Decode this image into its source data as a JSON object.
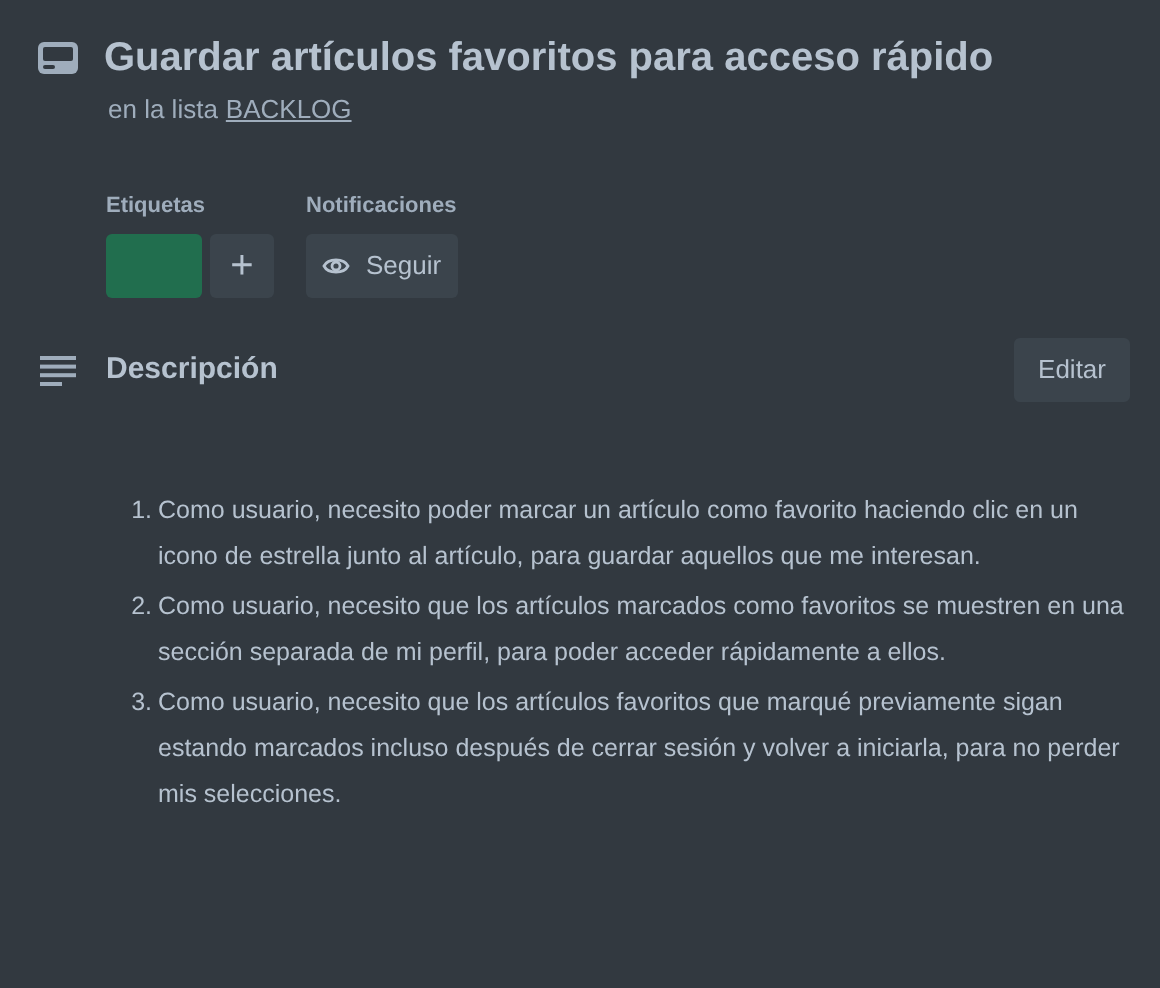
{
  "card": {
    "title": "Guardar artículos favoritos para acceso rápido",
    "list_prefix": "en la lista",
    "list_name": "BACKLOG"
  },
  "labels": {
    "heading": "Etiquetas",
    "items": [
      {
        "color": "#216e4e"
      }
    ],
    "add": "+"
  },
  "notifications": {
    "heading": "Notificaciones",
    "button": "Seguir"
  },
  "description": {
    "heading": "Descripción",
    "edit": "Editar",
    "items": [
      {
        "number": "1.",
        "text": "Como usuario, necesito poder marcar un artículo como favorito haciendo clic en un icono de estrella junto al artículo, para guardar aquellos que me interesan."
      },
      {
        "number": "2.",
        "text": "Como usuario, necesito que los artículos marcados como favoritos se muestren en una sección separada de mi perfil, para poder acceder rápidamente a ellos."
      },
      {
        "number": "3.",
        "text": "Como usuario, necesito que los artículos favoritos que marqué previamente sigan estando marcados incluso después de cerrar sesión y volver a iniciarla, para no perder mis selecciones."
      }
    ]
  }
}
